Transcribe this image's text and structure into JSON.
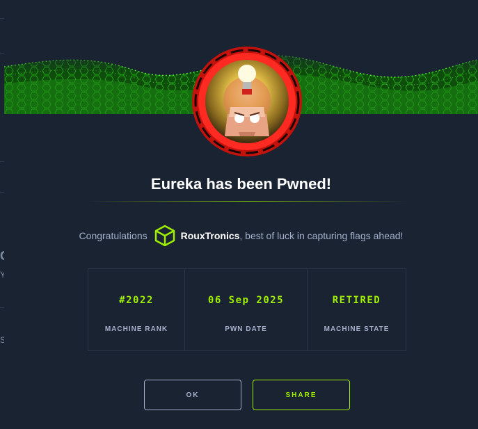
{
  "background_page": {
    "glyph_a": "C",
    "glyph_b": "Y",
    "glyph_c": "S"
  },
  "modal": {
    "title": "Eureka has been Pwned!",
    "congrats": {
      "prefix": "Congratulations",
      "username": "RouxTronics",
      "suffix": ", best of luck in capturing flags ahead!",
      "user_icon": "hackthebox-cube-icon"
    },
    "stats": [
      {
        "value": "#2022",
        "label": "MACHINE RANK"
      },
      {
        "value": "06 Sep 2025",
        "label": "PWN DATE"
      },
      {
        "value": "RETIRED",
        "label": "MACHINE STATE"
      }
    ],
    "buttons": {
      "ok": "OK",
      "share": "SHARE"
    },
    "avatar_icon": "lightbulb-head-avatar-icon"
  },
  "colors": {
    "accent": "#9fef00",
    "background": "#141d2b",
    "panel": "#1a2332",
    "text_muted": "#a4b1cd",
    "avatar_ring": "#e8231a"
  }
}
